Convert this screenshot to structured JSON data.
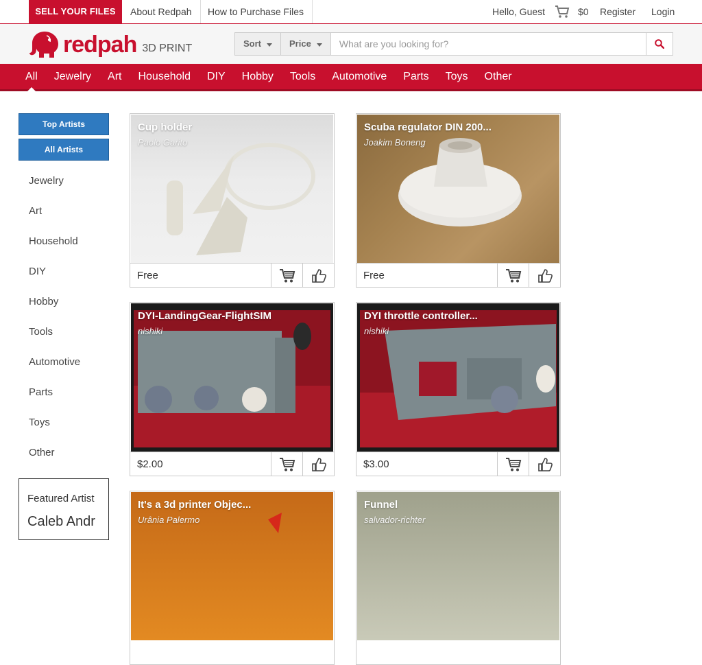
{
  "topbar": {
    "sell_label": "SELL YOUR FILES",
    "about_label": "About Redpah",
    "howto_label": "How to Purchase Files",
    "greeting": "Hello, Guest",
    "cart_total": "$0",
    "register_label": "Register",
    "login_label": "Login"
  },
  "logo": {
    "word": "redpah",
    "sub": "3D PRINT"
  },
  "search": {
    "sort_label": "Sort",
    "price_label": "Price",
    "placeholder": "What are you looking for?"
  },
  "categories": [
    "All",
    "Jewelry",
    "Art",
    "Household",
    "DIY",
    "Hobby",
    "Tools",
    "Automotive",
    "Parts",
    "Toys",
    "Other"
  ],
  "sidebar": {
    "top_artists_label": "Top Artists",
    "all_artists_label": "All Artists",
    "categories": [
      "Jewelry",
      "Art",
      "Household",
      "DIY",
      "Hobby",
      "Tools",
      "Automotive",
      "Parts",
      "Toys",
      "Other"
    ],
    "featured_title": "Featured Artist",
    "featured_name": "Caleb Andr"
  },
  "products": [
    {
      "title": "Cup holder",
      "author": "Paolo Garito",
      "price": "Free"
    },
    {
      "title": "Scuba regulator DIN 200...",
      "author": "Joakim Boneng",
      "price": "Free"
    },
    {
      "title": "DYI-LandingGear-FlightSIM",
      "author": "nishiki",
      "price": "$2.00"
    },
    {
      "title": "DYI throttle controller...",
      "author": "nishiki",
      "price": "$3.00"
    },
    {
      "title": "It's a 3d printer Objec...",
      "author": "Urânia Palermo",
      "price": ""
    },
    {
      "title": "Funnel",
      "author": "salvador-richter",
      "price": ""
    }
  ],
  "colors": {
    "brand_red": "#c8102e",
    "button_blue": "#2f7ac0"
  }
}
